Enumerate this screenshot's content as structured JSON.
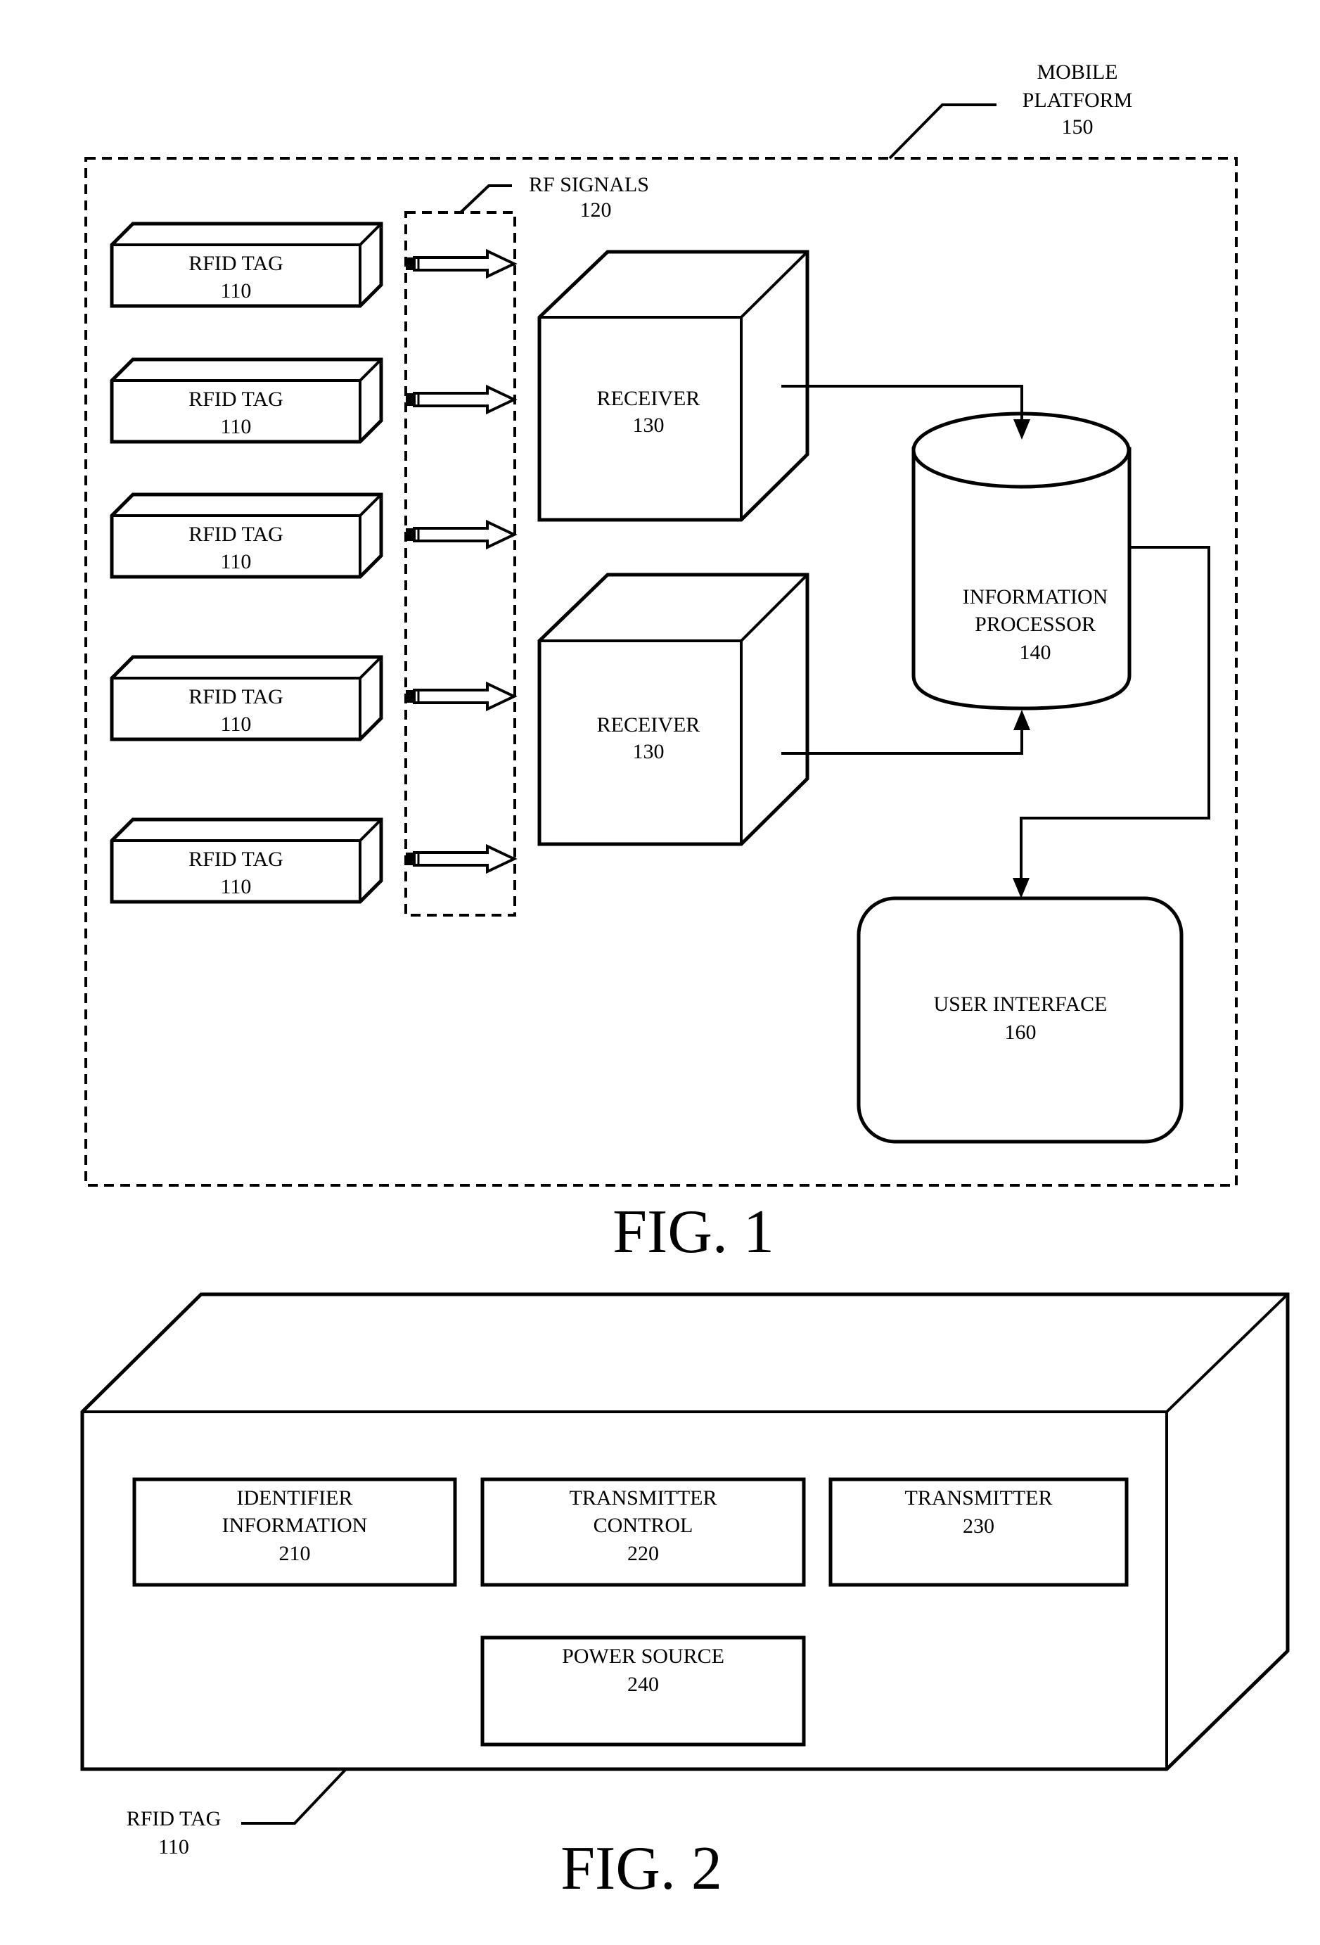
{
  "fig1": {
    "caption": "FIG. 1",
    "mobile_platform": {
      "line1": "MOBILE",
      "line2": "PLATFORM",
      "ref": "150"
    },
    "rf_signals": {
      "label": "RF SIGNALS",
      "ref": "120"
    },
    "rfid_tags": [
      {
        "label": "RFID TAG",
        "ref": "110"
      },
      {
        "label": "RFID TAG",
        "ref": "110"
      },
      {
        "label": "RFID TAG",
        "ref": "110"
      },
      {
        "label": "RFID TAG",
        "ref": "110"
      },
      {
        "label": "RFID TAG",
        "ref": "110"
      }
    ],
    "receivers": [
      {
        "label": "RECEIVER",
        "ref": "130"
      },
      {
        "label": "RECEIVER",
        "ref": "130"
      }
    ],
    "information_processor": {
      "line1": "INFORMATION",
      "line2": "PROCESSOR",
      "ref": "140"
    },
    "user_interface": {
      "label": "USER INTERFACE",
      "ref": "160"
    }
  },
  "fig2": {
    "caption": "FIG. 2",
    "callout": {
      "label": "RFID TAG",
      "ref": "110"
    },
    "components": [
      {
        "line1": "IDENTIFIER",
        "line2": "INFORMATION",
        "ref": "210"
      },
      {
        "line1": "TRANSMITTER",
        "line2": "CONTROL",
        "ref": "220"
      },
      {
        "line1": "TRANSMITTER",
        "line2": "",
        "ref": "230"
      },
      {
        "line1": "POWER SOURCE",
        "line2": "",
        "ref": "240"
      }
    ]
  }
}
